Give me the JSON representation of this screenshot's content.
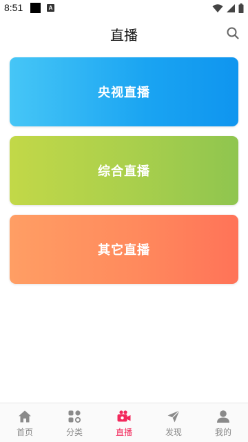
{
  "status_bar": {
    "time": "8:51",
    "notification_badge": "A"
  },
  "header": {
    "title": "直播",
    "search_icon": "search-icon"
  },
  "cards": [
    {
      "label": "央视直播",
      "gradient": [
        "#46c6f6",
        "#0f95ef"
      ]
    },
    {
      "label": "综合直播",
      "gradient": [
        "#c2d848",
        "#8fc54f"
      ]
    },
    {
      "label": "其它直播",
      "gradient": [
        "#ff9e64",
        "#ff7358"
      ]
    }
  ],
  "tabbar": {
    "active_color": "#f2295c",
    "inactive_color": "#8a8a8a",
    "tabs": [
      {
        "label": "首页",
        "icon": "home-icon",
        "active": false
      },
      {
        "label": "分类",
        "icon": "category-icon",
        "active": false
      },
      {
        "label": "直播",
        "icon": "live-camera-icon",
        "active": true
      },
      {
        "label": "发现",
        "icon": "paper-plane-icon",
        "active": false
      },
      {
        "label": "我的",
        "icon": "user-icon",
        "active": false
      }
    ]
  }
}
